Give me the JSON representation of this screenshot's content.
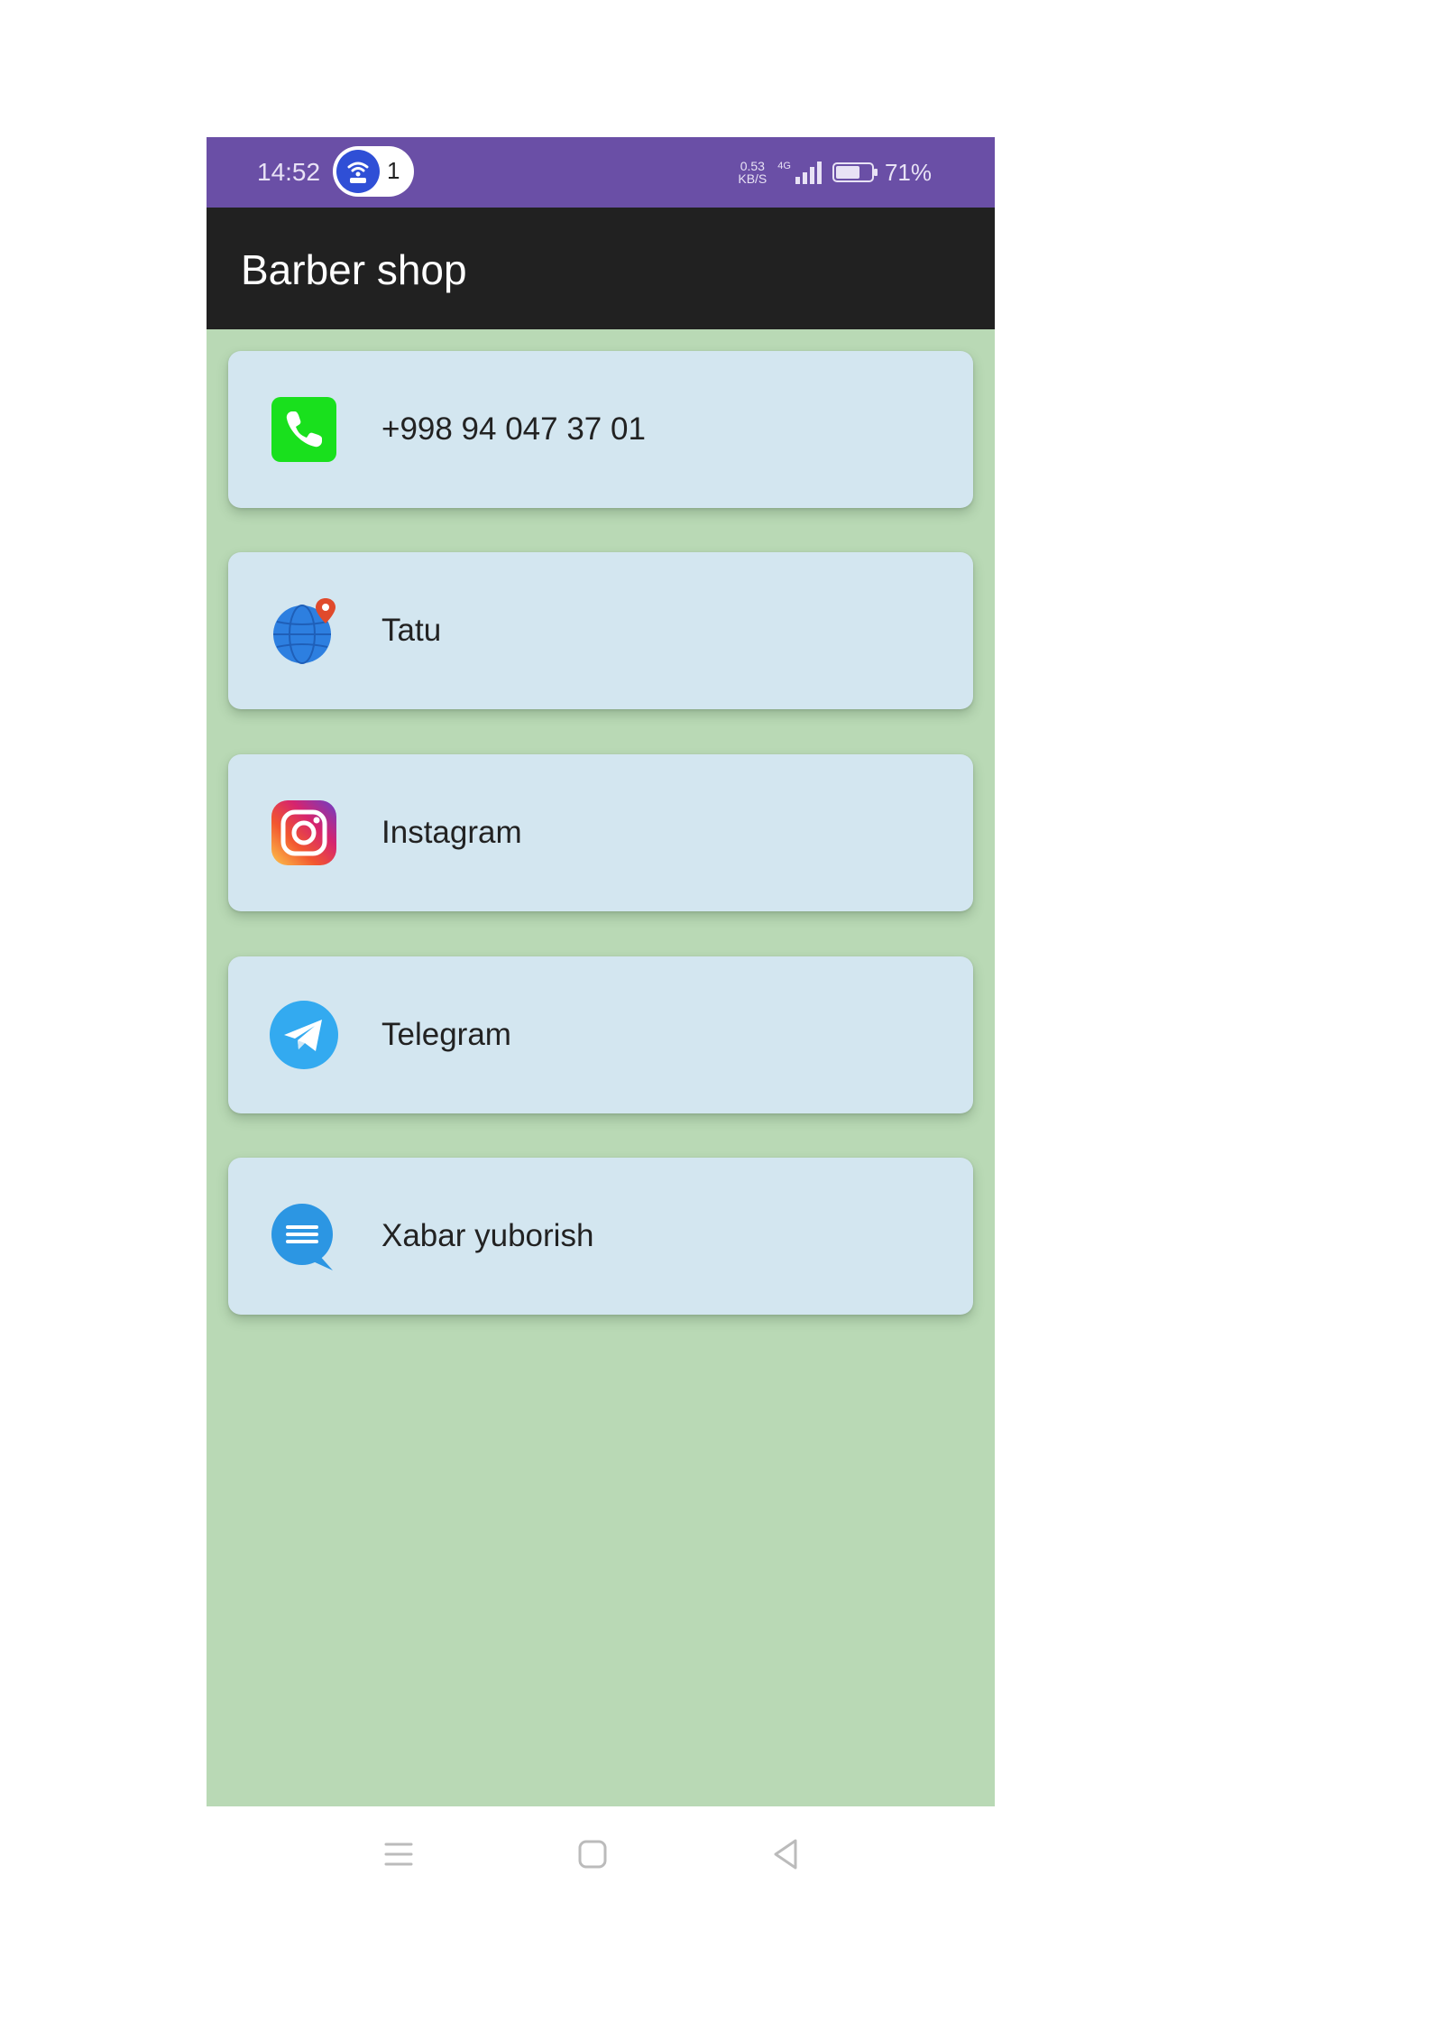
{
  "status_bar": {
    "time": "14:52",
    "hotspot_count": "1",
    "net_speed_value": "0.53",
    "net_speed_unit": "KB/S",
    "network_type": "4G",
    "battery_level": 0.71,
    "battery_text": "71%",
    "background_color": "#6a4fa6"
  },
  "app_bar": {
    "title": "Barber shop",
    "background_color": "#212121"
  },
  "content": {
    "background_color": "#b9d9b5",
    "card_color": "#d3e6f0",
    "items": [
      {
        "label": "+998 94 047 37 01",
        "icon": "phone-icon"
      },
      {
        "label": "Tatu",
        "icon": "location-globe-icon"
      },
      {
        "label": "Instagram",
        "icon": "instagram-icon"
      },
      {
        "label": "Telegram",
        "icon": "telegram-icon"
      },
      {
        "label": "Xabar yuborish",
        "icon": "message-icon"
      }
    ]
  },
  "nav_bar": {
    "buttons": [
      {
        "icon": "menu-icon"
      },
      {
        "icon": "home-icon"
      },
      {
        "icon": "back-icon"
      }
    ]
  }
}
